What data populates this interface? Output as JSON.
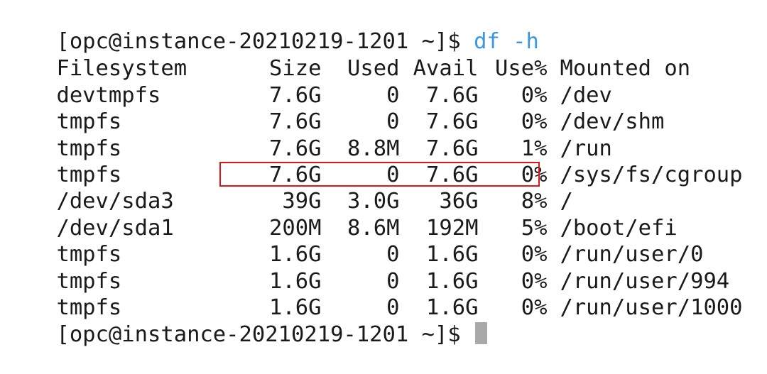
{
  "prompt": {
    "text": "[opc@instance-20210219-1201 ~]$ ",
    "command": "df -h"
  },
  "table": {
    "headers": {
      "filesystem": "Filesystem",
      "size": "Size",
      "used": "Used",
      "avail": "Avail",
      "use": "Use%",
      "mounted": "Mounted on"
    },
    "rows": [
      {
        "filesystem": "devtmpfs",
        "size": "7.6G",
        "used": "0",
        "avail": "7.6G",
        "use": "0%",
        "mounted": "/dev"
      },
      {
        "filesystem": "tmpfs",
        "size": "7.6G",
        "used": "0",
        "avail": "7.6G",
        "use": "0%",
        "mounted": "/dev/shm"
      },
      {
        "filesystem": "tmpfs",
        "size": "7.6G",
        "used": "8.8M",
        "avail": "7.6G",
        "use": "1%",
        "mounted": "/run"
      },
      {
        "filesystem": "tmpfs",
        "size": "7.6G",
        "used": "0",
        "avail": "7.6G",
        "use": "0%",
        "mounted": "/sys/fs/cgroup"
      },
      {
        "filesystem": "/dev/sda3",
        "size": "39G",
        "used": "3.0G",
        "avail": "36G",
        "use": "8%",
        "mounted": "/"
      },
      {
        "filesystem": "/dev/sda1",
        "size": "200M",
        "used": "8.6M",
        "avail": "192M",
        "use": "5%",
        "mounted": "/boot/efi"
      },
      {
        "filesystem": "tmpfs",
        "size": "1.6G",
        "used": "0",
        "avail": "1.6G",
        "use": "0%",
        "mounted": "/run/user/0"
      },
      {
        "filesystem": "tmpfs",
        "size": "1.6G",
        "used": "0",
        "avail": "1.6G",
        "use": "0%",
        "mounted": "/run/user/994"
      },
      {
        "filesystem": "tmpfs",
        "size": "1.6G",
        "used": "0",
        "avail": "1.6G",
        "use": "0%",
        "mounted": "/run/user/1000"
      }
    ]
  },
  "colors": {
    "command": "#3a96dd",
    "highlight_border": "#e0141a",
    "cursor": "#a9a9a9"
  }
}
